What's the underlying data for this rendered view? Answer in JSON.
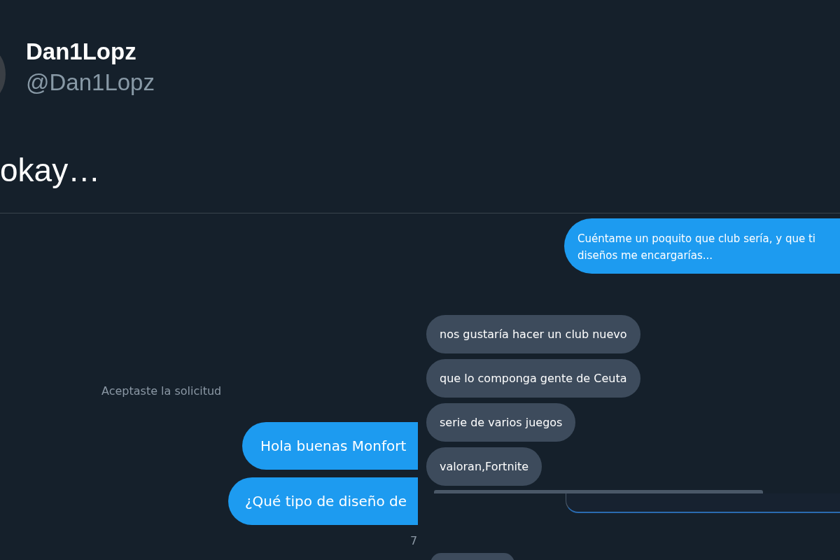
{
  "tweet": {
    "author": {
      "name": "Dan1Lopz",
      "handle": "@Dan1Lopz"
    },
    "text": "okay…"
  },
  "dm_screenshot": {
    "top_message": {
      "text": "Cuéntame un poquito que club sería, y que ti\ndiseños me encargarías..."
    },
    "system_notice": "Aceptaste la solicitud",
    "sent_messages": [
      {
        "text": "Hola buenas Monfort"
      },
      {
        "text": "¿Qué tipo de diseño de"
      }
    ],
    "count": "7",
    "received_messages": [
      {
        "text": "nos gustaría hacer un club nuevo"
      },
      {
        "text": "que lo componga gente de Ceuta"
      },
      {
        "text": "serie de varios juegos"
      },
      {
        "text": "valoran,Fortnite"
      }
    ]
  }
}
